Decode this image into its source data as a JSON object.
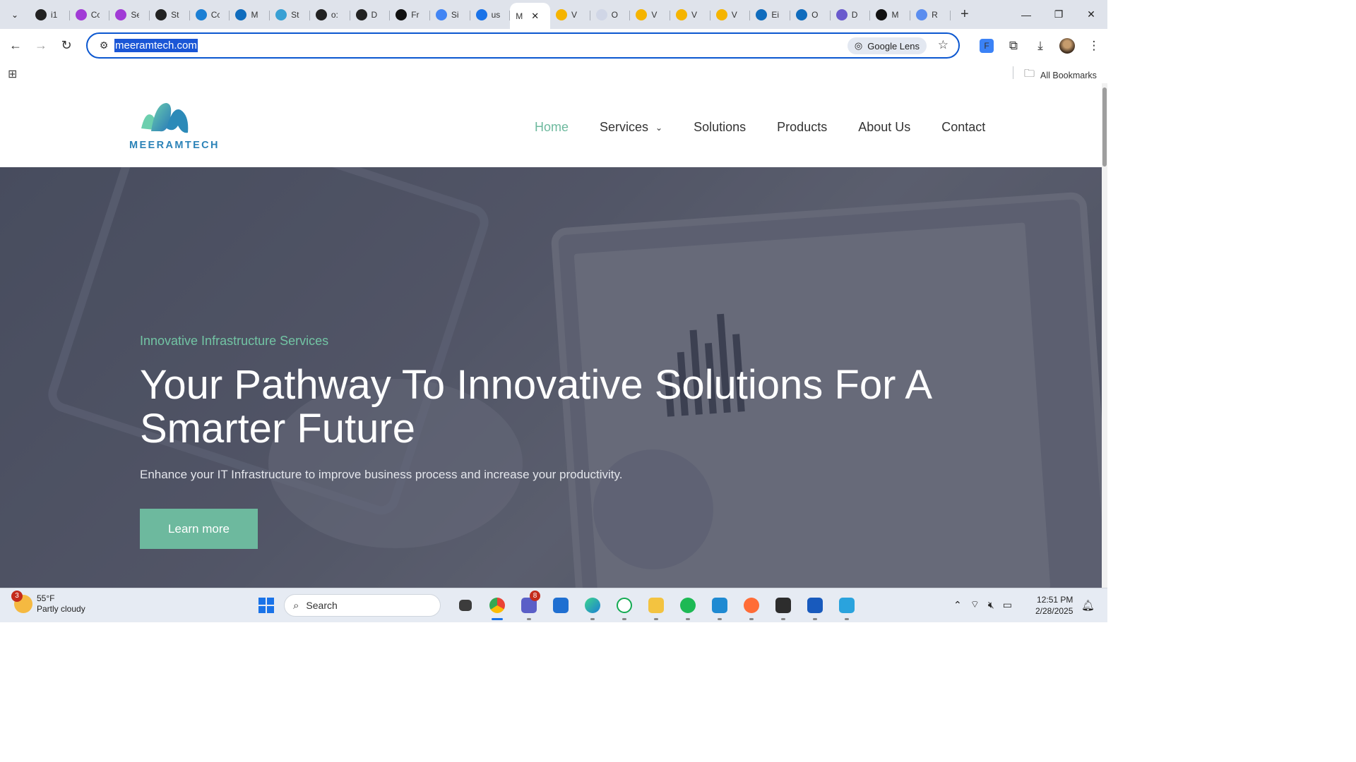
{
  "browser": {
    "tabs": [
      {
        "label": "i1",
        "color": "#222222"
      },
      {
        "label": "Cc",
        "color": "#a13bd6"
      },
      {
        "label": "Se",
        "color": "#a13bd6"
      },
      {
        "label": "St",
        "color": "#222222"
      },
      {
        "label": "Cc",
        "color": "#1b7fd4"
      },
      {
        "label": "M",
        "color": "#0f6cbd"
      },
      {
        "label": "St",
        "color": "#38a0d4"
      },
      {
        "label": "o:",
        "color": "#222222"
      },
      {
        "label": "D",
        "color": "#222222"
      },
      {
        "label": "Fr",
        "color": "#111111"
      },
      {
        "label": "Si",
        "color": "#4285f4"
      },
      {
        "label": "us",
        "color": "#1a73e8"
      },
      {
        "label": "M",
        "color": "#ffffff",
        "active": true
      },
      {
        "label": "V",
        "color": "#f5b400"
      },
      {
        "label": "O",
        "color": "#d0d6e6"
      },
      {
        "label": "V",
        "color": "#f5b400"
      },
      {
        "label": "V",
        "color": "#f5b400"
      },
      {
        "label": "V",
        "color": "#f5b400"
      },
      {
        "label": "Ei",
        "color": "#0f6cbd"
      },
      {
        "label": "O",
        "color": "#0f6cbd"
      },
      {
        "label": "D",
        "color": "#6a5acd"
      },
      {
        "label": "M",
        "color": "#111111"
      },
      {
        "label": "R",
        "color": "#5b8def"
      }
    ],
    "active_tab_close": "✕",
    "new_tab": "+",
    "url": "meeramtech.com",
    "google_lens": "Google Lens",
    "all_bookmarks": "All Bookmarks",
    "window_controls": {
      "minimize": "—",
      "restore": "❐",
      "close": "✕"
    }
  },
  "site": {
    "logo_text": "MEERAMTECH",
    "nav": [
      {
        "label": "Home",
        "active": true
      },
      {
        "label": "Services",
        "dropdown": true
      },
      {
        "label": "Solutions"
      },
      {
        "label": "Products"
      },
      {
        "label": "About Us"
      },
      {
        "label": "Contact"
      }
    ],
    "hero": {
      "subtitle": "Innovative Infrastructure Services",
      "title": "Your Pathway To Innovative Solutions For A Smarter Future",
      "description": "Enhance your IT Infrastructure to improve business process and increase your productivity.",
      "button": "Learn more"
    },
    "accent_color": "#6db99e"
  },
  "taskbar": {
    "weather": {
      "badge": "3",
      "temp": "55°F",
      "condition": "Partly cloudy"
    },
    "search_placeholder": "Search",
    "teams_badge": "8",
    "time": "12:51 PM",
    "date": "2/28/2025"
  }
}
